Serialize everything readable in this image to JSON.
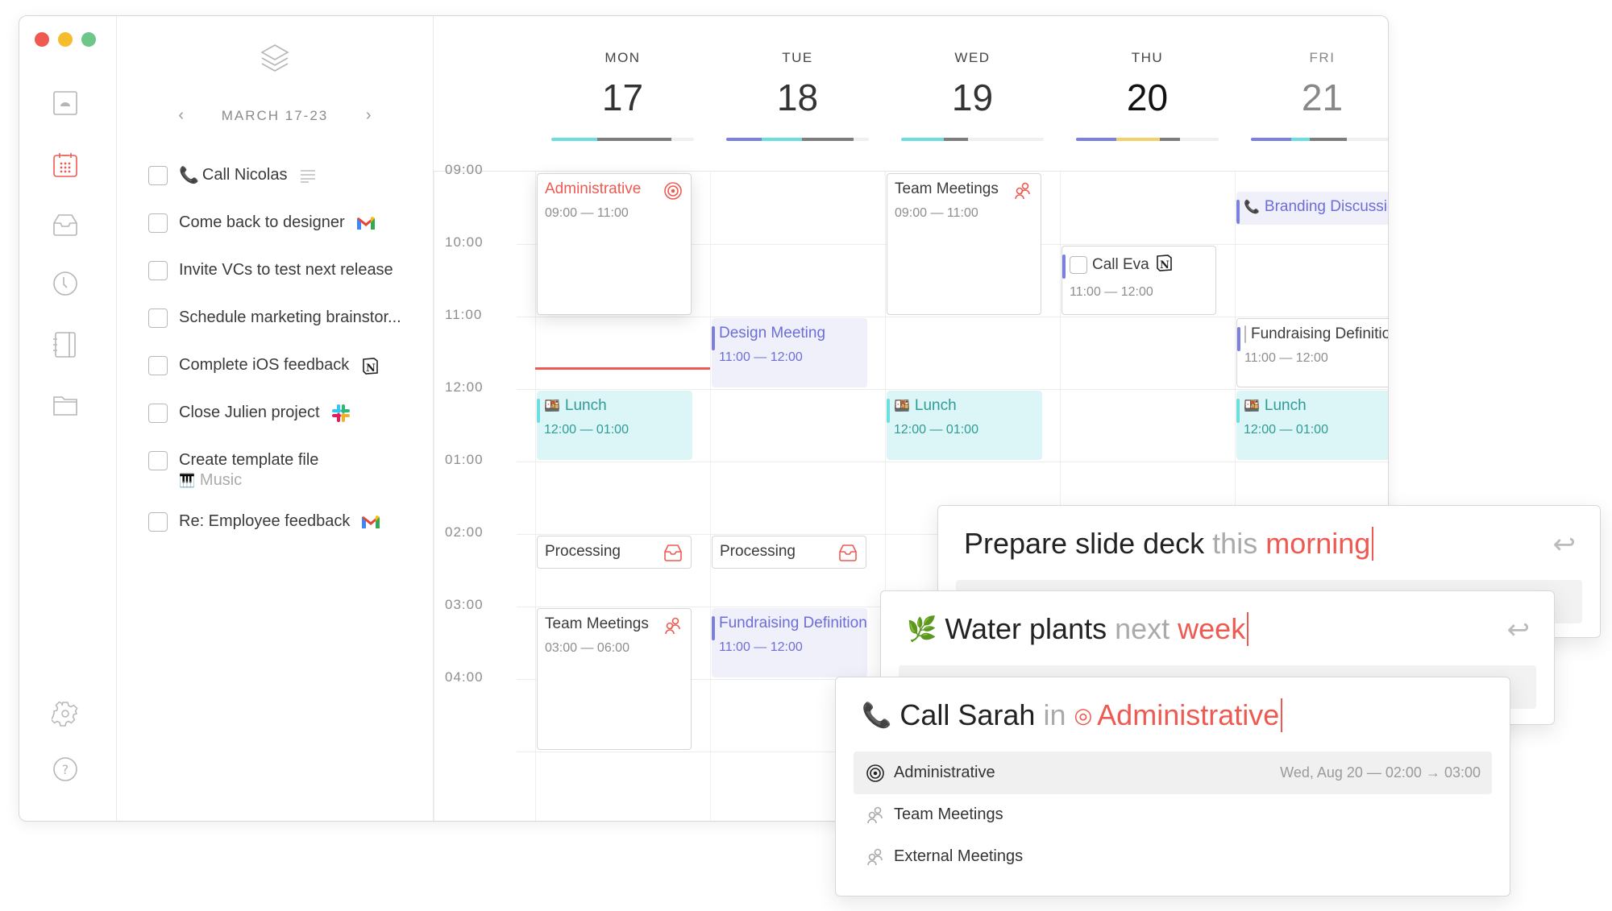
{
  "window": {
    "traffic_lights": [
      "close",
      "minimize",
      "zoom"
    ]
  },
  "sidebar": {
    "items": [
      {
        "name": "today",
        "icon": "sunrise-icon",
        "active": false
      },
      {
        "name": "calendar",
        "icon": "calendar-icon",
        "active": true
      },
      {
        "name": "inbox",
        "icon": "inbox-icon",
        "active": false
      },
      {
        "name": "history",
        "icon": "clock-icon",
        "active": false
      },
      {
        "name": "notebook",
        "icon": "notebook-icon",
        "active": false
      },
      {
        "name": "projects",
        "icon": "folder-icon",
        "active": false
      }
    ],
    "bottom": [
      {
        "name": "settings",
        "icon": "gear-icon"
      },
      {
        "name": "help",
        "icon": "help-icon",
        "glyph": "?"
      }
    ]
  },
  "task_panel": {
    "week_label": "MARCH 17-23",
    "prev_glyph": "‹",
    "next_glyph": "›",
    "tasks": [
      {
        "prefix_emoji": "📞",
        "label": "Call Nicolas",
        "app": "notes-lines"
      },
      {
        "label": "Come back to designer",
        "app": "gmail"
      },
      {
        "label": "Invite VCs to test next release",
        "app": ""
      },
      {
        "label": "Schedule marketing brainstor...",
        "app": ""
      },
      {
        "label": "Complete iOS feedback",
        "app": "notion"
      },
      {
        "label": "Close Julien project",
        "app": "slack"
      },
      {
        "label": "Create template file",
        "app": "",
        "sub_emoji": "🎹",
        "sub_label": "Music"
      },
      {
        "label": "Re: Employee feedback",
        "app": "gmail"
      }
    ]
  },
  "calendar": {
    "days": [
      {
        "name": "MON",
        "num": "17",
        "bar": [
          {
            "color": "#6bdfe0",
            "frac": 0.32
          },
          {
            "color": "#7d7d7d",
            "frac": 0.52
          }
        ]
      },
      {
        "name": "TUE",
        "num": "18",
        "bar": [
          {
            "color": "#7b7fe0",
            "frac": 0.25
          },
          {
            "color": "#6bdfe0",
            "frac": 0.28
          },
          {
            "color": "#7d7d7d",
            "frac": 0.36
          }
        ]
      },
      {
        "name": "WED",
        "num": "19",
        "bar": [
          {
            "color": "#6bdfe0",
            "frac": 0.3
          },
          {
            "color": "#7d7d7d",
            "frac": 0.17
          }
        ]
      },
      {
        "name": "THU",
        "num": "20",
        "today": true,
        "bar": [
          {
            "color": "#7b7fe0",
            "frac": 0.28
          },
          {
            "color": "#f3d06a",
            "frac": 0.31
          },
          {
            "color": "#7d7d7d",
            "frac": 0.14
          }
        ]
      },
      {
        "name": "FRI",
        "num": "21",
        "dim": true,
        "bar": [
          {
            "color": "#7b7fe0",
            "frac": 0.28
          },
          {
            "color": "#6bdfe0",
            "frac": 0.13
          },
          {
            "color": "#7d7d7d",
            "frac": 0.26
          }
        ]
      }
    ],
    "hours": [
      "09:00",
      "10:00",
      "11:00",
      "12:00",
      "01:00",
      "02:00",
      "03:00",
      "04:00"
    ],
    "events": [
      {
        "day": 0,
        "start": 0,
        "end": 2,
        "style": "white admin",
        "title": "Administrative",
        "time": "09:00 — 11:00",
        "icon": "target-icon"
      },
      {
        "day": 2,
        "start": 0,
        "end": 2,
        "style": "white",
        "title": "Team Meetings",
        "time": "09:00 — 11:00",
        "icon": "people-icon"
      },
      {
        "day": 4,
        "start": 0.25,
        "end": 0.75,
        "style": "purple",
        "title": "Branding Discussion",
        "prefix_emoji": "📞",
        "time": ""
      },
      {
        "day": 3,
        "start": 1,
        "end": 2,
        "style": "white accent",
        "title": "Call Eva",
        "checkbox": true,
        "app": "notion",
        "time": "11:00 — 12:00"
      },
      {
        "day": 1,
        "start": 2,
        "end": 3,
        "style": "purple",
        "title": "Design Meeting",
        "time": "11:00 — 12:00"
      },
      {
        "day": 4,
        "start": 2,
        "end": 3,
        "style": "white accent",
        "title": "Fundraising Definition",
        "checkbox": true,
        "time": "11:00 — 12:00"
      },
      {
        "day": 0,
        "start": 3,
        "end": 4,
        "style": "teal",
        "title": "Lunch",
        "prefix_emoji": "🍱",
        "time": "12:00 — 01:00"
      },
      {
        "day": 2,
        "start": 3,
        "end": 4,
        "style": "teal",
        "title": "Lunch",
        "prefix_emoji": "🍱",
        "time": "12:00 — 01:00"
      },
      {
        "day": 4,
        "start": 3,
        "end": 4,
        "style": "teal",
        "title": "Lunch",
        "prefix_emoji": "🍱",
        "time": "12:00 — 01:00"
      },
      {
        "day": 0,
        "start": 5,
        "end": 5.5,
        "style": "white",
        "title": "Processing",
        "time": "",
        "icon": "inbox-icon"
      },
      {
        "day": 1,
        "start": 5,
        "end": 5.5,
        "style": "white",
        "title": "Processing",
        "time": "",
        "icon": "inbox-icon"
      },
      {
        "day": 0,
        "start": 6,
        "end": 8,
        "style": "white",
        "title": "Team Meetings",
        "time": "03:00 — 06:00",
        "icon": "people-icon"
      },
      {
        "day": 1,
        "start": 6,
        "end": 7,
        "style": "purple",
        "title": "Fundraising Definition",
        "time": "11:00 — 12:00"
      }
    ],
    "now_line": {
      "day": 0,
      "hour_offset": 2.7
    }
  },
  "quick_add": [
    {
      "text": "Prepare slide deck",
      "muted": "this",
      "accent": "morning",
      "enter_glyph": "↩"
    },
    {
      "emoji": "🌿",
      "text": "Water plants",
      "muted": "next",
      "accent": "week",
      "enter_glyph": "↩"
    },
    {
      "emoji": "📞",
      "text": "Call Sarah",
      "muted": "in",
      "accent_icon": "◎",
      "accent": "Administrative",
      "options": [
        {
          "icon": "target-icon",
          "label": "Administrative",
          "meta": "Wed, Aug 20 — 02:00 → 03:00",
          "selected": true
        },
        {
          "icon": "people-icon",
          "label": "Team Meetings",
          "meta": ""
        },
        {
          "icon": "people-icon",
          "label": "External Meetings",
          "meta": ""
        }
      ]
    }
  ],
  "colors": {
    "accent_red": "#ee5a52",
    "purple": "#7b7fe0",
    "teal": "#6bdfe0",
    "yellow": "#f3d06a"
  }
}
